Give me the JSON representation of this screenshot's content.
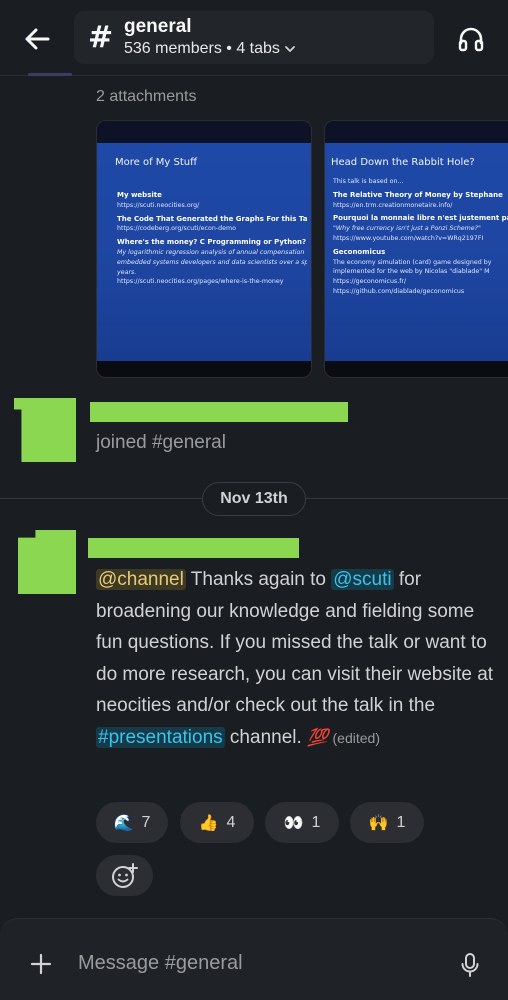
{
  "header": {
    "channel_hash": "#",
    "channel_name": "general",
    "meta": "536 members • 4 tabs",
    "icons": {
      "back": "back-arrow-icon",
      "dropdown": "chevron-down-icon",
      "huddle": "headphones-icon"
    }
  },
  "attachments": {
    "label": "2 attachments",
    "items": [
      {
        "title": "More of My Stuff",
        "lines": [
          {
            "text": "My website",
            "style": "b"
          },
          {
            "text": "https://scuti.neocities.org/",
            "style": ""
          },
          {
            "text": "The Code That Generated the Graphs For this Talk",
            "style": "b"
          },
          {
            "text": "https://codeberg.org/scuti/econ-demo",
            "style": ""
          },
          {
            "text": "Where's the money? C Programming or Python?",
            "style": "b"
          },
          {
            "text": "My logarithmic regression analysis of annual compensation",
            "style": "i"
          },
          {
            "text": "embedded systems developers and data scientists over a sp",
            "style": "i"
          },
          {
            "text": "years.",
            "style": "i"
          },
          {
            "text": "https://scuti.neocities.org/pages/where-is-the-money",
            "style": ""
          }
        ]
      },
      {
        "title": "Head Down the Rabbit Hole?",
        "lines": [
          {
            "text": "This talk is based on...",
            "style": ""
          },
          {
            "text": "The Relative Theory of Money by Stephane",
            "style": "b"
          },
          {
            "text": "https://en.trm.creationmonetaire.info/",
            "style": ""
          },
          {
            "text": "Pourquoi la monnaie libre n'est justement pa",
            "style": "b"
          },
          {
            "text": "\"Why free currency isn't just a Ponzi Scheme?\"",
            "style": "i"
          },
          {
            "text": "https://www.youtube.com/watch?v=WRq2197FI",
            "style": ""
          },
          {
            "text": "Geconomicus",
            "style": "b"
          },
          {
            "text": "The economy simulation (card) game designed by",
            "style": ""
          },
          {
            "text": "implemented for the web by Nicolas \"diablade\" M",
            "style": ""
          },
          {
            "text": "https://geconomicus.fr/",
            "style": ""
          },
          {
            "text": "https://github.com/diablade/geconomicus",
            "style": ""
          }
        ]
      }
    ]
  },
  "join_event": {
    "text": "joined #general"
  },
  "date_divider": "Nov 13th",
  "message": {
    "mention_channel": "@channel",
    "part1": " Thanks again to ",
    "mention_user": "@scuti",
    "part2": " for broadening our knowledge and fielding some fun questions. If you missed the talk or want to do more research, you can visit their website at neocities and/or check out the talk in the ",
    "channel_link": "#presentations",
    "part3": " channel. ",
    "emoji": "💯",
    "edited": "(edited)"
  },
  "reactions": [
    {
      "emoji": "🌊",
      "icon": "wave-icon",
      "count": "7"
    },
    {
      "emoji": "👍",
      "icon": "thumbs-up-icon",
      "count": "4"
    },
    {
      "emoji": "👀",
      "icon": "eyes-icon",
      "count": "1"
    },
    {
      "emoji": "🙌",
      "icon": "raised-hands-icon",
      "count": "1"
    }
  ],
  "composer": {
    "placeholder": "Message #general",
    "icons": {
      "add": "plus-icon",
      "mic": "microphone-icon",
      "add_reaction": "add-reaction-icon"
    }
  },
  "colors": {
    "background": "#1a1d21",
    "avatar": "#8bd752",
    "mention_channel": "#e8c97a",
    "mention_link": "#36c5f0"
  }
}
